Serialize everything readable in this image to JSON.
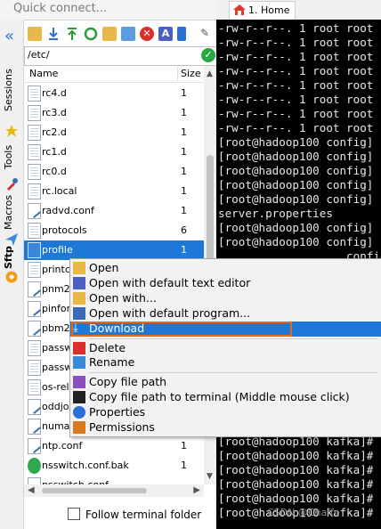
{
  "quick_connect": {
    "placeholder": "Quick connect..."
  },
  "terminal_tab": {
    "label": "1. Home",
    "icon": "home-icon"
  },
  "sidebar": {
    "tabs": [
      "Sessions",
      "Tools",
      "Macros",
      "Sftp"
    ],
    "active": "Sftp"
  },
  "toolbar": {
    "icons": [
      "up-folder-icon",
      "download-icon",
      "upload-icon",
      "refresh-icon",
      "new-folder-icon",
      "new-file-icon",
      "delete-icon",
      "text-editor-icon",
      "properties-icon"
    ]
  },
  "path": {
    "value": "/etc/"
  },
  "filelist": {
    "columns": {
      "name": "Name",
      "size": "Size"
    },
    "rows": [
      {
        "name": "rc4.d",
        "size": "1",
        "type": "folder"
      },
      {
        "name": "rc3.d",
        "size": "1",
        "type": "folder"
      },
      {
        "name": "rc2.d",
        "size": "1",
        "type": "folder"
      },
      {
        "name": "rc1.d",
        "size": "1",
        "type": "folder"
      },
      {
        "name": "rc0.d",
        "size": "1",
        "type": "folder"
      },
      {
        "name": "rc.local",
        "size": "1",
        "type": "folder"
      },
      {
        "name": "radvd.conf",
        "size": "1",
        "type": "conf"
      },
      {
        "name": "protocols",
        "size": "6",
        "type": "folder"
      },
      {
        "name": "profile",
        "size": "1",
        "type": "selected"
      },
      {
        "name": "printca",
        "size": "",
        "type": "folder"
      },
      {
        "name": "pnm2p",
        "size": "",
        "type": "conf"
      },
      {
        "name": "pinforc",
        "size": "",
        "type": "conf"
      },
      {
        "name": "pbm2p",
        "size": "",
        "type": "conf"
      },
      {
        "name": "passw",
        "size": "",
        "type": "folder"
      },
      {
        "name": "passw",
        "size": "",
        "type": "folder"
      },
      {
        "name": "os-rele",
        "size": "",
        "type": "folder"
      },
      {
        "name": "oddjob",
        "size": "",
        "type": "conf"
      },
      {
        "name": "numac",
        "size": "",
        "type": "conf"
      },
      {
        "name": "ntp.conf",
        "size": "1",
        "type": "conf"
      },
      {
        "name": "nsswitch.conf.bak",
        "size": "1",
        "type": "bak"
      },
      {
        "name": "nsswitch.conf",
        "size": "",
        "type": "conf"
      }
    ]
  },
  "follow_terminal": {
    "label": "Follow terminal folder",
    "checked": false
  },
  "terminal": {
    "lines": [
      "-rw-r--r--. 1 root root",
      "-rw-r--r--. 1 root root",
      "-rw-r--r--. 1 root root",
      "-rw-r--r--. 1 root root",
      "-rw-r--r--. 1 root root",
      "-rw-r--r--. 1 root root",
      "-rw-r--r--. 1 root root",
      "-rw-r--r--. 1 root root",
      "[root@hadoop100 config]",
      "[root@hadoop100 config]",
      "[root@hadoop100 config]",
      "[root@hadoop100 config]",
      "[root@hadoop100 config]",
      "server.properties",
      "[root@hadoop100 config]",
      "[root@hadoop100 config]",
      "                   config]",
      "                   fig]",
      "                   fig]",
      "                   kafka]#",
      "                   kafka]#",
      "                   kafka]#",
      "",
      "",
      "",
      "                   kafka]#",
      "                   kafka]#",
      "                   kafka]#",
      "                   kafka]#",
      "[root@hadoop100 kafka]#",
      "[root@hadoop100 kafka]#",
      "[root@hadoop100 kafka]#",
      "[root@hadoop100 kafka]#",
      "[root@hadoop100 kafka]#",
      "[root@hadoop100 kafka]#"
    ]
  },
  "context_menu": {
    "items": [
      {
        "label": "Open",
        "icon": "folder-open-icon"
      },
      {
        "label": "Open with default text editor",
        "icon": "text-editor-icon"
      },
      {
        "label": "Open with...",
        "icon": "open-with-icon"
      },
      {
        "label": "Open with default program...",
        "icon": "paperclip-icon"
      },
      {
        "label": "Download",
        "icon": "download-icon",
        "highlighted": true
      },
      {
        "label": "Delete",
        "icon": "delete-icon"
      },
      {
        "label": "Rename",
        "icon": "rename-icon"
      },
      {
        "label": "Copy file path",
        "icon": "copy-path-icon"
      },
      {
        "label": "Copy file path to terminal (Middle mouse click)",
        "icon": "terminal-icon"
      },
      {
        "label": "Properties",
        "icon": "info-icon"
      },
      {
        "label": "Permissions",
        "icon": "permissions-icon"
      }
    ]
  },
  "watermark": {
    "text": "CSDN @Chaffe"
  },
  "colors": {
    "selection": "#1e78d6",
    "highlight_border": "#e06a1f",
    "terminal_bg": "#000000"
  }
}
